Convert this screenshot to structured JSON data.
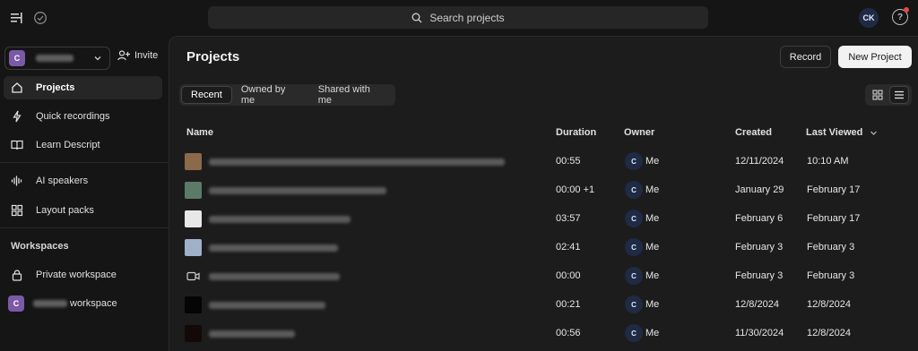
{
  "topbar": {
    "search_placeholder": "Search projects",
    "user_initials": "CK"
  },
  "sidebar": {
    "workspace_initial": "C",
    "invite_label": "Invite",
    "nav": [
      {
        "label": "Projects",
        "icon": "home-icon",
        "active": true
      },
      {
        "label": "Quick recordings",
        "icon": "bolt-icon"
      },
      {
        "label": "Learn Descript",
        "icon": "book-icon"
      },
      {
        "label": "AI speakers",
        "icon": "waveform-icon"
      },
      {
        "label": "Layout packs",
        "icon": "layout-icon"
      }
    ],
    "workspaces_heading": "Workspaces",
    "workspaces": [
      {
        "label": "Private workspace",
        "icon": "lock-icon"
      },
      {
        "label": "workspace",
        "initial": "C"
      }
    ]
  },
  "main": {
    "title": "Projects",
    "record_label": "Record",
    "new_project_label": "New Project",
    "tabs": [
      "Recent",
      "Owned by me",
      "Shared with me"
    ],
    "active_tab": "Recent",
    "columns": {
      "name": "Name",
      "duration": "Duration",
      "owner": "Owner",
      "created": "Created",
      "last_viewed": "Last Viewed"
    },
    "rows": [
      {
        "duration": "00:55",
        "owner_initial": "C",
        "owner": "Me",
        "created": "12/11/2024",
        "last_viewed": "10:10 AM",
        "thumb_color": "#8a6a4a"
      },
      {
        "duration": "00:00 +1",
        "owner_initial": "C",
        "owner": "Me",
        "created": "January 29",
        "last_viewed": "February 17",
        "thumb_color": "#5c7a6a"
      },
      {
        "duration": "03:57",
        "owner_initial": "C",
        "owner": "Me",
        "created": "February 6",
        "last_viewed": "February 17",
        "thumb_color": "#e8e8e8"
      },
      {
        "duration": "02:41",
        "owner_initial": "C",
        "owner": "Me",
        "created": "February 3",
        "last_viewed": "February 3",
        "thumb_color": "#9fb0c8"
      },
      {
        "duration": "00:00",
        "owner_initial": "C",
        "owner": "Me",
        "created": "February 3",
        "last_viewed": "February 3",
        "thumb_color": "video-icon"
      },
      {
        "duration": "00:21",
        "owner_initial": "C",
        "owner": "Me",
        "created": "12/8/2024",
        "last_viewed": "12/8/2024",
        "thumb_color": "#050505"
      },
      {
        "duration": "00:56",
        "owner_initial": "C",
        "owner": "Me",
        "created": "11/30/2024",
        "last_viewed": "12/8/2024",
        "thumb_color": "#140808"
      }
    ]
  }
}
